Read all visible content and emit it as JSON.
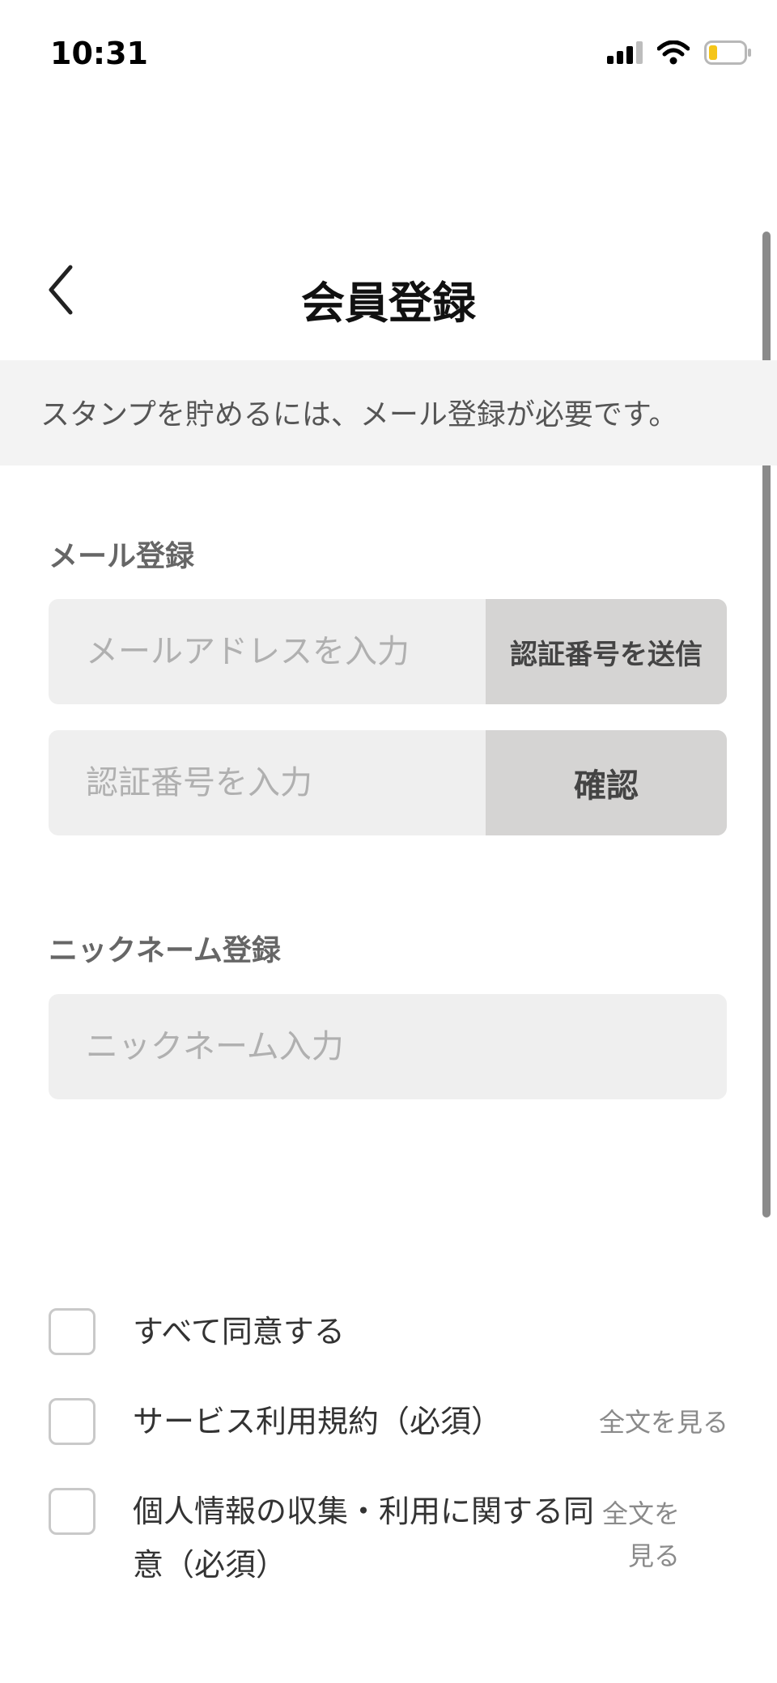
{
  "status_bar": {
    "time": "10:31",
    "icons": [
      "signal-icon",
      "wifi-icon",
      "battery-icon"
    ],
    "battery_color": "#f5c518"
  },
  "header": {
    "back_icon": "chevron-left-icon",
    "title": "会員登録"
  },
  "banner": {
    "text": "スタンプを貯めるには、メール登録が必要です。"
  },
  "email_section": {
    "label": "メール登録",
    "email_placeholder": "メールアドレスを入力",
    "send_code_label": "認証番号を送信",
    "code_placeholder": "認証番号を入力",
    "confirm_label": "確認"
  },
  "nickname_section": {
    "label": "ニックネーム登録",
    "placeholder": "ニックネーム入力"
  },
  "agreements": {
    "all_label": "すべて同意する",
    "items": [
      {
        "label": "サービス利用規約（必須）",
        "link": "全文を見る"
      },
      {
        "label_line1": "個人情報の収集・利用に関する同",
        "label_line2": "意（必須）",
        "link_line1": "全文を",
        "link_line2": "見る"
      }
    ]
  }
}
